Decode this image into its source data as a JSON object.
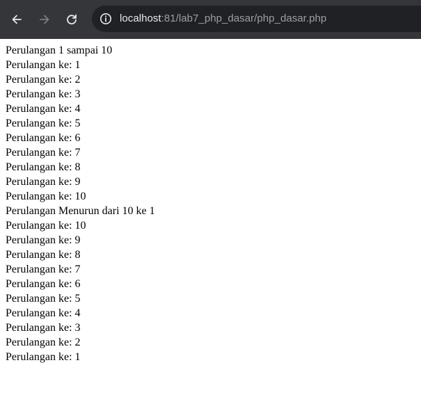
{
  "browser": {
    "url_host": "localhost",
    "url_rest": ":81/lab7_php_dasar/php_dasar.php",
    "icons": {
      "back": "arrow-left-icon",
      "forward": "arrow-right-icon",
      "reload": "reload-icon",
      "site_info": "info-icon"
    }
  },
  "page": {
    "lines": [
      "Perulangan 1 sampai 10",
      "Perulangan ke: 1",
      "Perulangan ke: 2",
      "Perulangan ke: 3",
      "Perulangan ke: 4",
      "Perulangan ke: 5",
      "Perulangan ke: 6",
      "Perulangan ke: 7",
      "Perulangan ke: 8",
      "Perulangan ke: 9",
      "Perulangan ke: 10",
      "Perulangan Menurun dari 10 ke 1",
      "Perulangan ke: 10",
      "Perulangan ke: 9",
      "Perulangan ke: 8",
      "Perulangan ke: 7",
      "Perulangan ke: 6",
      "Perulangan ke: 5",
      "Perulangan ke: 4",
      "Perulangan ke: 3",
      "Perulangan ke: 2",
      "Perulangan ke: 1"
    ]
  }
}
